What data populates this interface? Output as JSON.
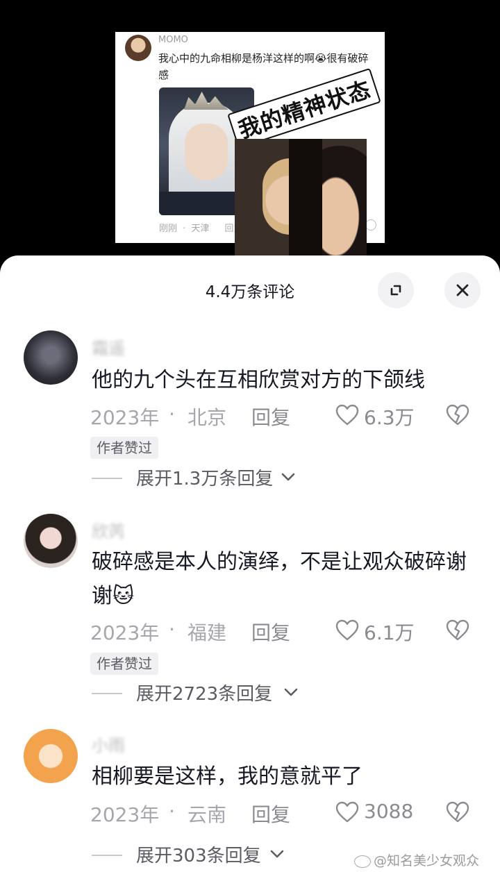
{
  "video": {
    "screenshot": {
      "username": "MOMO",
      "text": "我心中的九命相柳是杨洋这样的啊😭很有破碎感",
      "meta": "刚刚 · 天津",
      "reply": "回复"
    },
    "sticker_text": "我的精神状态"
  },
  "sheet": {
    "title": "4.4万条评论",
    "expand_icon": "expand-icon",
    "close_icon": "close-icon"
  },
  "comments": [
    {
      "username": "霜遥",
      "text": "他的九个头在互相欣赏对方的下颌线",
      "year": "2023年",
      "dot": "·",
      "location": "北京",
      "reply": "回复",
      "likes": "6.3万",
      "badge": "作者赞过",
      "expand": "展开1.3万条回复"
    },
    {
      "username": "欣芮",
      "text": "破碎感是本人的演绎，不是让观众破碎谢谢🐱",
      "year": "2023年",
      "dot": "·",
      "location": "福建",
      "reply": "回复",
      "likes": "6.1万",
      "badge": "作者赞过",
      "expand": "展开2723条回复"
    },
    {
      "username": "小雨",
      "text": "相柳要是这样，我的意就平了",
      "year": "2023年",
      "dot": "·",
      "location": "云南",
      "reply": "回复",
      "likes": "3088",
      "expand": "展开303条回复"
    }
  ],
  "watermark": "@知名美少女观众"
}
